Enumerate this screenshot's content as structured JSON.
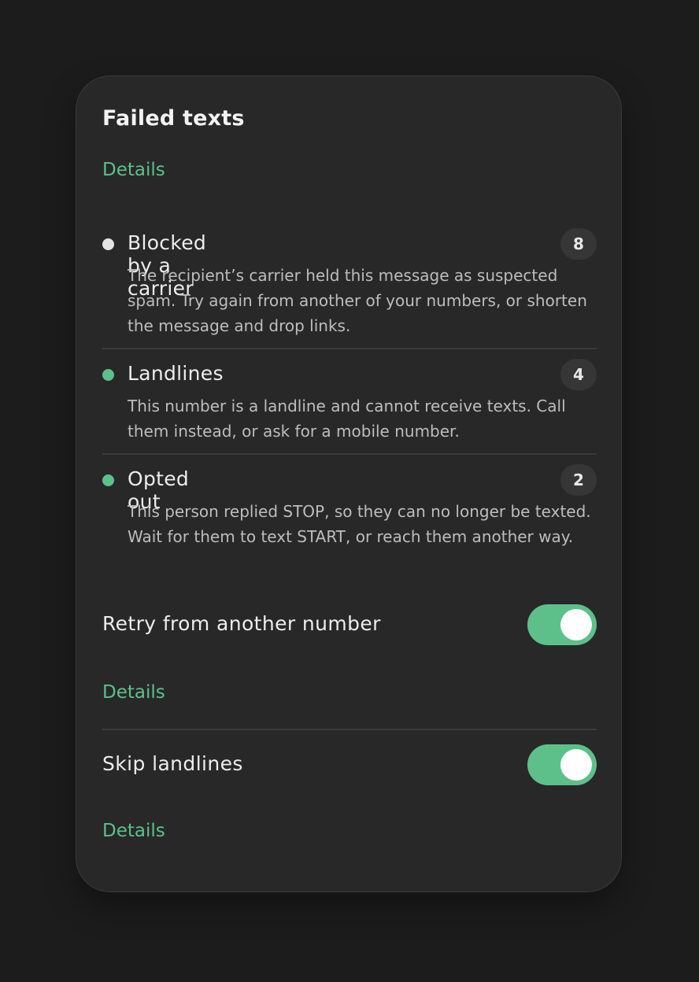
{
  "card": {
    "title": "Failed texts",
    "details_label": "Details"
  },
  "items": [
    {
      "title": "Blocked by a carrier",
      "count": "8",
      "description": "The recipient’s carrier held this message as suspected spam. Try again from another of your numbers, or shorten the message and drop links.",
      "dot_color": "#e4e4e4"
    },
    {
      "title": "Landlines",
      "count": "4",
      "description": "This number is a landline and cannot receive texts. Call them instead, or ask for a mobile number.",
      "dot_color": "#5dc08b"
    },
    {
      "title": "Opted out",
      "count": "2",
      "description": "This person replied STOP, so they can no longer be texted. Wait for them to text START, or reach them another way.",
      "dot_color": "#5dc08b"
    }
  ],
  "settings": [
    {
      "label": "Retry from another number",
      "enabled": true,
      "details_label": "Details"
    },
    {
      "label": "Skip landlines",
      "enabled": true,
      "details_label": "Details"
    }
  ],
  "colors": {
    "accent": "#5dc08b",
    "card_background": "#282828",
    "page_background": "#1c1c1c"
  }
}
